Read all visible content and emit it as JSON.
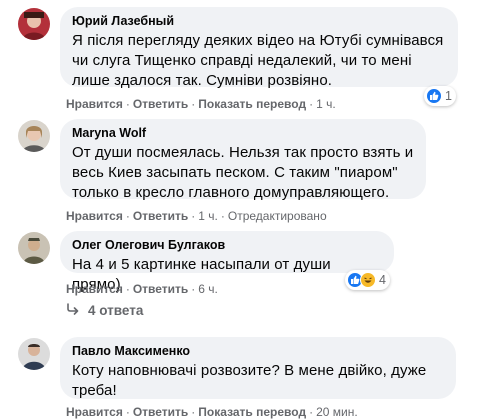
{
  "comments": [
    {
      "author": "Юрий Лазебный",
      "lines": [
        "Я після перегляду деяких відео на Ютубі сумнівався",
        "чи слуга Тищенко справді недалекий, чи то мені",
        "лише здалося так. Сумніви розвіяно."
      ],
      "like_label": "Нравится",
      "reply_label": "Ответить",
      "translate_label": "Показать перевод",
      "time": "1 ч.",
      "reaction_count": "1"
    },
    {
      "author": "Maryna Wolf",
      "lines": [
        "От души посмеялась. Нельзя так просто взять и",
        "весь Киев засыпать песком. С таким \"пиаром\"",
        "только в кресло главного домуправляющего."
      ],
      "like_label": "Нравится",
      "reply_label": "Ответить",
      "time": "1 ч.",
      "edited_label": "Отредактировано"
    },
    {
      "author": "Олег Олегович Булгаков",
      "lines": [
        "На 4 и 5 картинке насыпали от души прямо)"
      ],
      "like_label": "Нравится",
      "reply_label": "Ответить",
      "time": "6 ч.",
      "reaction_count": "4"
    },
    {
      "author": "Павло Максименко",
      "lines": [
        "Коту наповнювачі розвозите? В мене двійко, дуже",
        "треба!"
      ],
      "like_label": "Нравится",
      "reply_label": "Ответить",
      "translate_label": "Показать перевод",
      "time": "20 мин."
    }
  ],
  "replies_link": "4 ответа",
  "separator": "·",
  "icons": {
    "like": "thumbs-up-icon",
    "haha": "haha-icon",
    "reply_arrow": "reply-arrow-icon"
  },
  "colors": {
    "bubble": "#f0f2f5",
    "meta_text": "#65676b",
    "like_blue": "#1877f2",
    "haha_yellow": "#f7b928"
  }
}
